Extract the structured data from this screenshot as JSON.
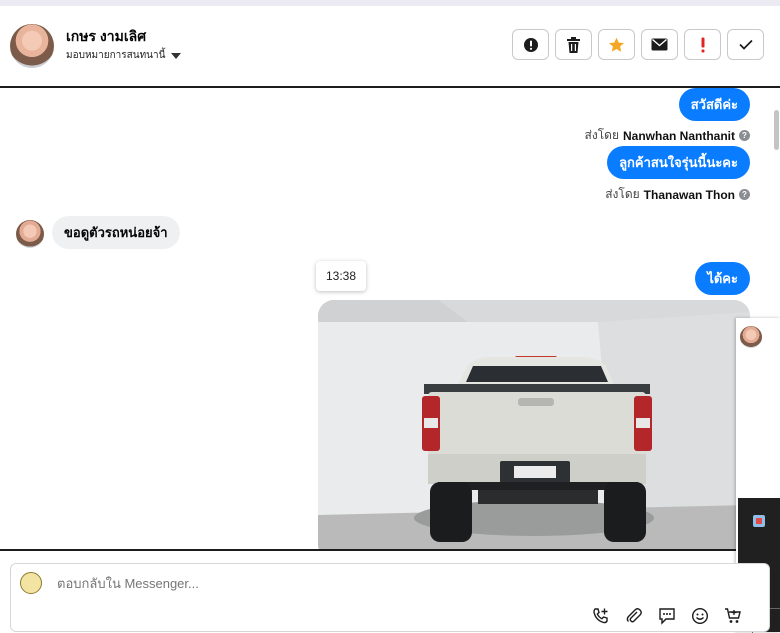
{
  "header": {
    "contact_name": "เกษร งามเลิศ",
    "assign_label": "มอบหมายการสนทนานี้",
    "actions": [
      {
        "name": "alert-circle-icon"
      },
      {
        "name": "trash-icon"
      },
      {
        "name": "star-icon"
      },
      {
        "name": "envelope-icon"
      },
      {
        "name": "exclamation-icon"
      },
      {
        "name": "check-icon"
      }
    ]
  },
  "thread": {
    "messages": [
      {
        "text": "สวัสดีค่ะ",
        "sent_by_prefix": "ส่งโดย",
        "sent_by_name": "Nanwhan Nanthanit"
      },
      {
        "text": "ลูกค้าสนใจรุ่นนี้นะคะ",
        "sent_by_prefix": "ส่งโดย",
        "sent_by_name": "Thanawan Thon"
      },
      {
        "text": "ขอดูตัวรถหน่อยจ้า"
      },
      {
        "text": "ได้คะ"
      }
    ],
    "time_chip": "13:38",
    "photo_alt_icon": "pickup-truck-photo"
  },
  "composer": {
    "placeholder": "ตอบกลับใน Messenger..."
  },
  "colors": {
    "outgoing_bubble": "#0a7cff",
    "incoming_bubble": "#eef0f2",
    "star": "#f5a623",
    "exclamation": "#e02424"
  }
}
